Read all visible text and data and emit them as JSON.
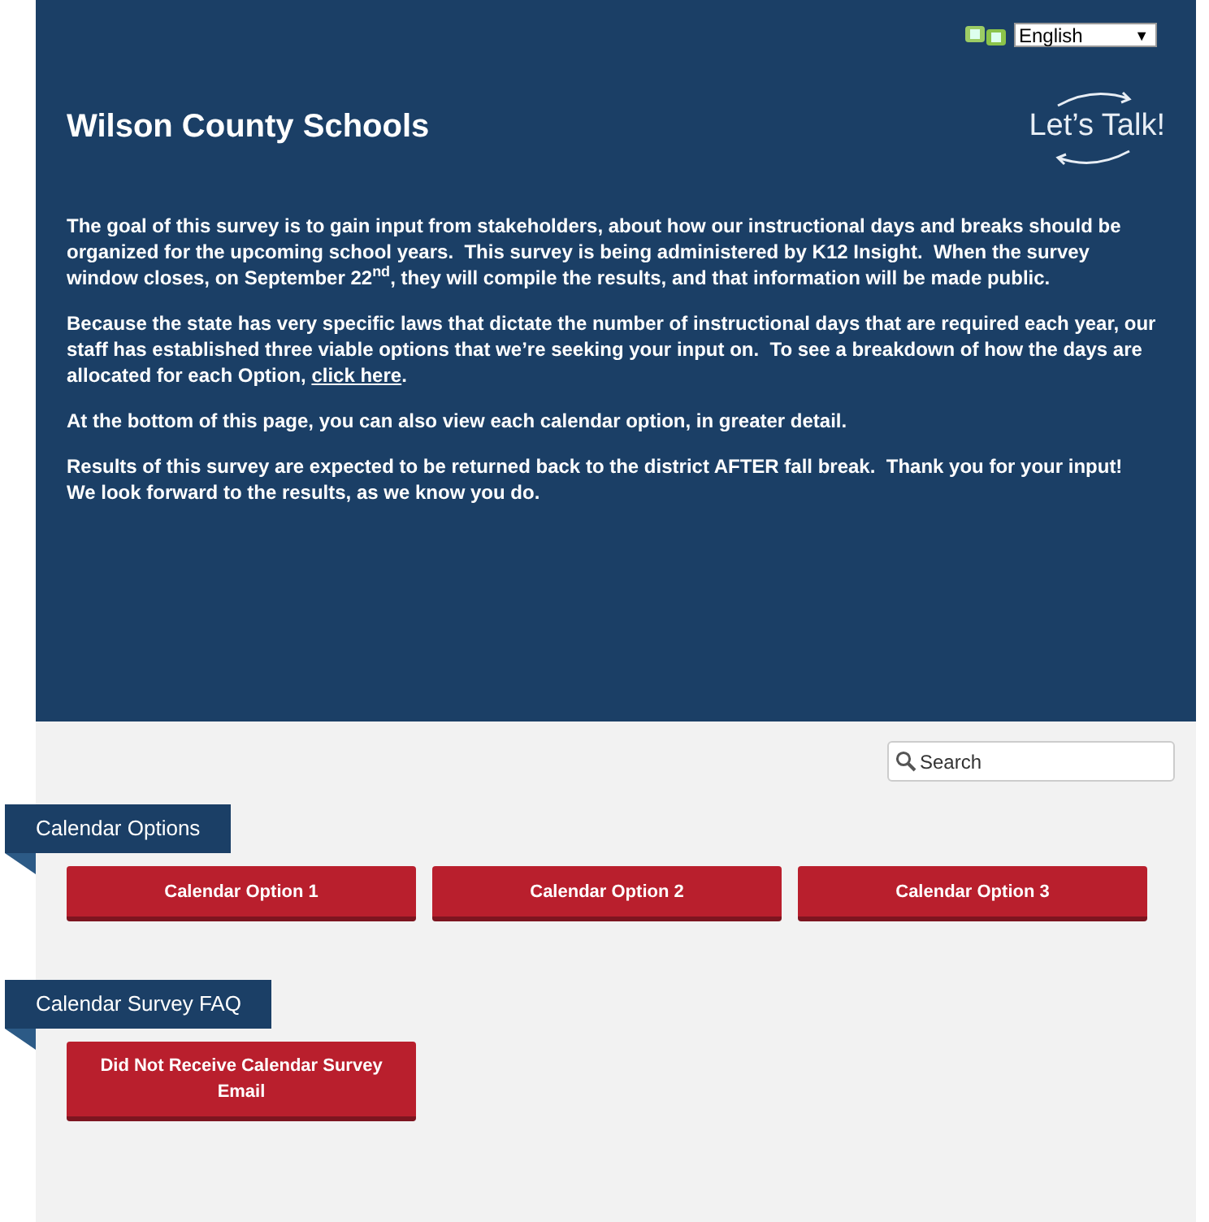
{
  "language": {
    "value": "English",
    "caret": "▼"
  },
  "header": {
    "title": "Wilson County Schools",
    "logo": "Let’s Talk!"
  },
  "paragraphs": [
    {
      "text": "The goal of this survey is to gain input from stakeholders, about how our instructional days and breaks should be organized for the upcoming school years.  This survey is being administered by K12 Insight.  When the survey window closes, on September 22$^{nd}$, they will compile the results, and that information will be made public."
    },
    {
      "text": "Because the state has very specific laws that dictate the number of instructional days that are required each year, our staff has established three viable options that we’re seeking your input on.  To see a breakdown of how the days are allocated for each Option, ",
      "link": "click here",
      "after": "."
    },
    {
      "text": "At the bottom of this page, you can also view each calendar option, in greater detail."
    },
    {
      "text": "Results of this survey are expected to be returned back to the district AFTER fall break.  Thank you for your input!  We look forward to the results, as we know you do."
    }
  ],
  "search": {
    "placeholder": "Search"
  },
  "sections": [
    {
      "title": "Calendar Options",
      "buttons": [
        "Calendar Option 1",
        "Calendar Option 2",
        "Calendar Option 3"
      ]
    },
    {
      "title": "Calendar Survey FAQ",
      "buttons": [
        "Did Not Receive Calendar Survey Email"
      ]
    }
  ]
}
